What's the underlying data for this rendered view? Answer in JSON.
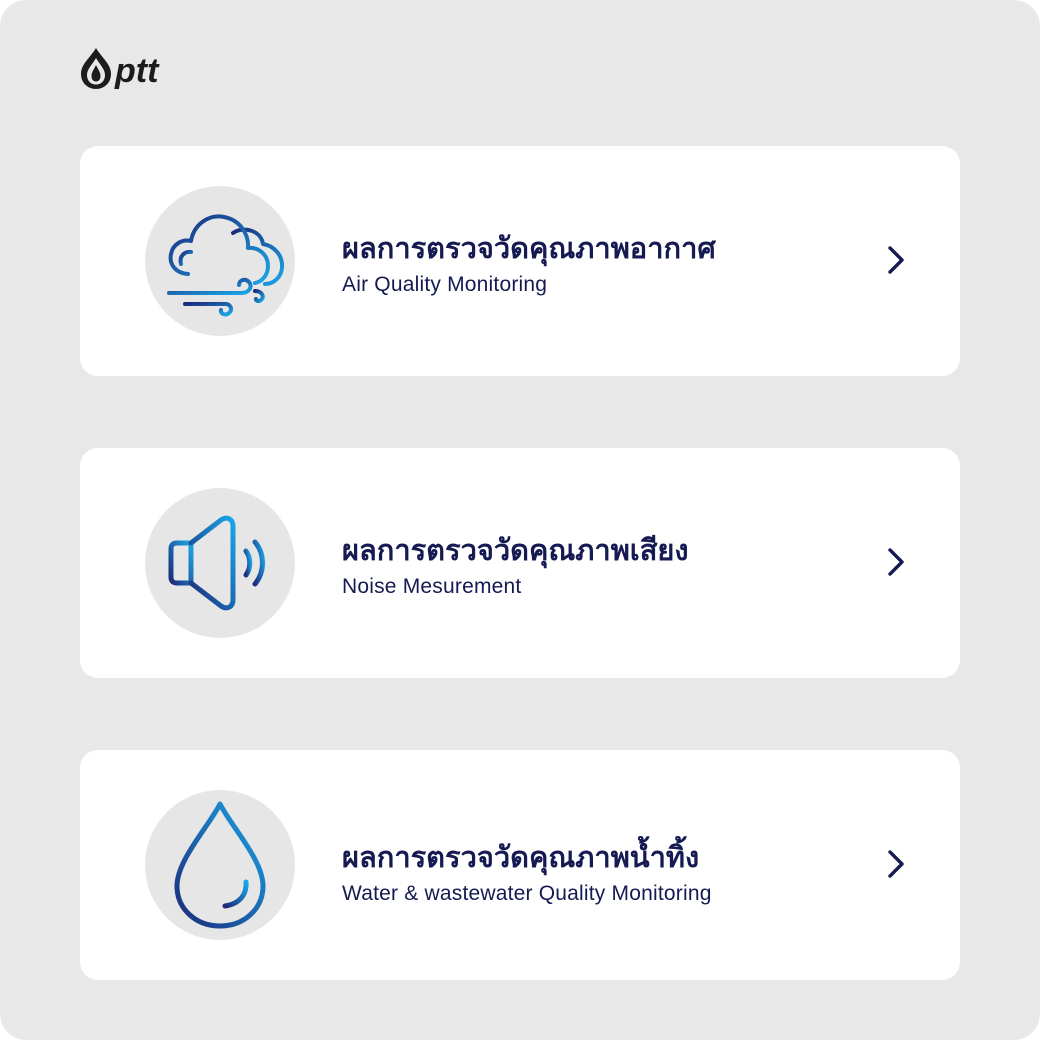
{
  "brand": {
    "logo_text": "ptt",
    "primary_color": "#151a52",
    "accent_color": "#1ba6e8"
  },
  "cards": [
    {
      "title_th": "ผลการตรวจวัดคุณภาพอากาศ",
      "title_en": "Air Quality Monitoring",
      "icon": "cloud-wind-icon"
    },
    {
      "title_th": "ผลการตรวจวัดคุณภาพเสียง",
      "title_en": "Noise Mesurement",
      "icon": "speaker-icon"
    },
    {
      "title_th": "ผลการตรวจวัดคุณภาพน้ำทิ้ง",
      "title_en": "Water & wastewater Quality Monitoring",
      "icon": "water-drop-icon"
    }
  ]
}
